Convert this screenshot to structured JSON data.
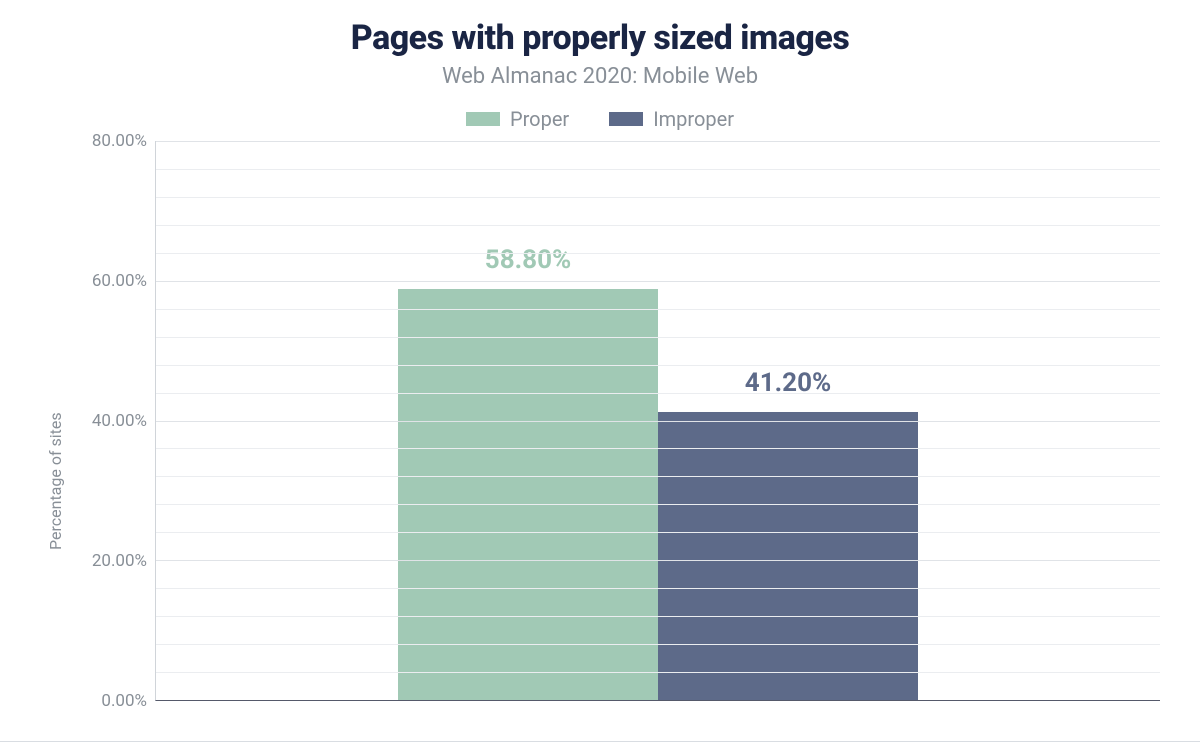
{
  "chart_data": {
    "type": "bar",
    "title": "Pages with properly sized images",
    "subtitle": "Web Almanac 2020: Mobile Web",
    "ylabel": "Percentage of sites",
    "xlabel": "",
    "ylim": [
      0,
      80
    ],
    "y_ticks": [
      0,
      20,
      40,
      60,
      80
    ],
    "y_tick_labels": [
      "0.00%",
      "20.00%",
      "40.00%",
      "60.00%",
      "80.00%"
    ],
    "minor_gridlines_per_major": 4,
    "series": [
      {
        "name": "Proper",
        "color": "#a1c9b5",
        "values": [
          58.8
        ],
        "value_labels": [
          "58.80%"
        ]
      },
      {
        "name": "Improper",
        "color": "#5d6a89",
        "values": [
          41.2
        ],
        "value_labels": [
          "41.20%"
        ]
      }
    ],
    "legend": {
      "items": [
        {
          "label": "Proper",
          "color": "#a1c9b5"
        },
        {
          "label": "Improper",
          "color": "#5d6a89"
        }
      ]
    }
  }
}
